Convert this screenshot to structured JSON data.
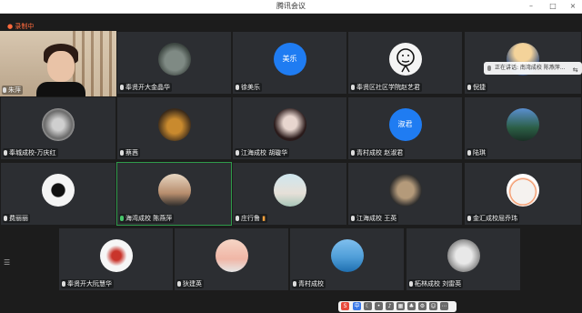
{
  "window": {
    "title": "腾讯会议"
  },
  "status": {
    "recording_label": "录制中"
  },
  "speaking_banner": {
    "text": "正在讲话: 南湾成校 陈燕萍..."
  },
  "side_menu": {
    "icon": "list-icon"
  },
  "tiles": [
    {
      "label": "朱萍",
      "mic": "muted"
    },
    {
      "label": "奉贤开大金晶华",
      "mic": "muted"
    },
    {
      "label": "徐美乐",
      "mic": "muted",
      "avatar_text": "美乐"
    },
    {
      "label": "奉贤区社区学院赵艺君",
      "mic": "muted"
    },
    {
      "label": "倪捷",
      "mic": "muted"
    },
    {
      "label": "奉城成校-万庆红",
      "mic": "muted"
    },
    {
      "label": "蔡茜",
      "mic": "muted"
    },
    {
      "label": "江海成校 胡璇华",
      "mic": "muted"
    },
    {
      "label": "青村成校 赵淑君",
      "mic": "muted",
      "avatar_text": "淑君"
    },
    {
      "label": "陆琪",
      "mic": "muted"
    },
    {
      "label": "费丽丽",
      "mic": "muted"
    },
    {
      "label": "海湾成校 陈燕萍",
      "mic": "speaking"
    },
    {
      "label": "庄行鲁",
      "mic": "muted"
    },
    {
      "label": "江海成校 王英",
      "mic": "muted"
    },
    {
      "label": "金汇成校屈乔玮",
      "mic": "muted"
    },
    {
      "label": "奉贤开大阮慧华",
      "mic": "muted"
    },
    {
      "label": "狄建英",
      "mic": "muted"
    },
    {
      "label": "青村成校",
      "mic": "muted"
    },
    {
      "label": "柘林成校 刘雷英",
      "mic": "muted"
    }
  ]
}
